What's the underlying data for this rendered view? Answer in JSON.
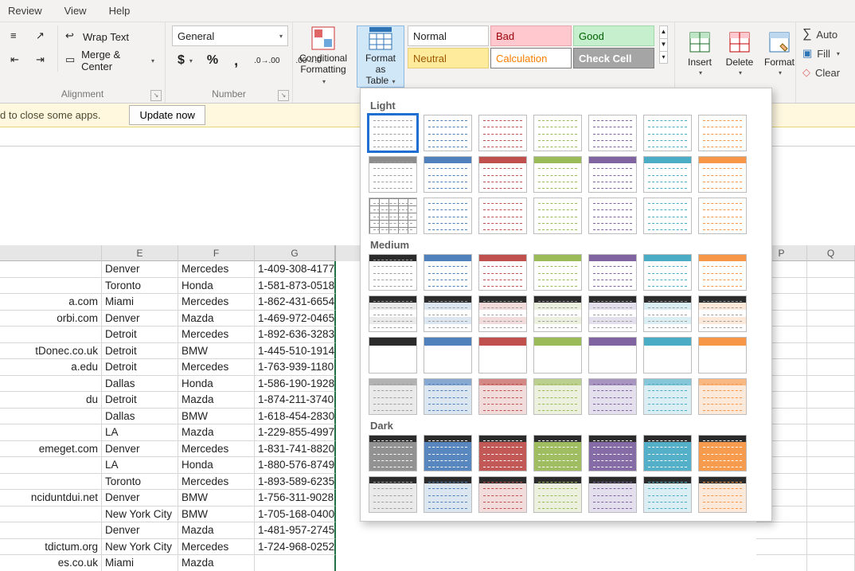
{
  "menu": {
    "review": "Review",
    "view": "View",
    "help": "Help"
  },
  "alignment": {
    "wrap": "Wrap Text",
    "merge": "Merge & Center",
    "group": "Alignment"
  },
  "number": {
    "format": "General",
    "group": "Number"
  },
  "cond_fmt": {
    "line1": "Conditional",
    "line2": "Formatting"
  },
  "fmt_table": {
    "line1": "Format as",
    "line2": "Table"
  },
  "styles": {
    "normal": "Normal",
    "bad": "Bad",
    "good": "Good",
    "neutral": "Neutral",
    "calc": "Calculation",
    "check": "Check Cell"
  },
  "cells": {
    "insert": "Insert",
    "delete": "Delete",
    "format": "Format"
  },
  "editing": {
    "autosum": "Auto",
    "fill": "Fill",
    "clear": "Clear"
  },
  "notif": {
    "msg": "d to close some apps.",
    "btn": "Update now"
  },
  "headers": {
    "e": "E",
    "f": "F",
    "g": "G",
    "p": "P",
    "q": "Q"
  },
  "rows": [
    {
      "d": "",
      "e": "Denver",
      "f": "Mercedes",
      "g": "1-409-308-4177"
    },
    {
      "d": "",
      "e": "Toronto",
      "f": "Honda",
      "g": "1-581-873-0518"
    },
    {
      "d": "a.com",
      "e": "Miami",
      "f": "Mercedes",
      "g": "1-862-431-6654"
    },
    {
      "d": "orbi.com",
      "e": "Denver",
      "f": "Mazda",
      "g": "1-469-972-0465"
    },
    {
      "d": "",
      "e": "Detroit",
      "f": "Mercedes",
      "g": "1-892-636-3283"
    },
    {
      "d": "tDonec.co.uk",
      "e": "Detroit",
      "f": "BMW",
      "g": "1-445-510-1914"
    },
    {
      "d": "a.edu",
      "e": "Detroit",
      "f": "Mercedes",
      "g": "1-763-939-1180"
    },
    {
      "d": "",
      "e": "Dallas",
      "f": "Honda",
      "g": "1-586-190-1928"
    },
    {
      "d": "du",
      "e": "Detroit",
      "f": "Mazda",
      "g": "1-874-211-3740"
    },
    {
      "d": "",
      "e": "Dallas",
      "f": "BMW",
      "g": "1-618-454-2830"
    },
    {
      "d": "",
      "e": "LA",
      "f": "Mazda",
      "g": "1-229-855-4997"
    },
    {
      "d": "emeget.com",
      "e": "Denver",
      "f": "Mercedes",
      "g": "1-831-741-8820"
    },
    {
      "d": "",
      "e": "LA",
      "f": "Honda",
      "g": "1-880-576-8749"
    },
    {
      "d": "",
      "e": "Toronto",
      "f": "Mercedes",
      "g": "1-893-589-6235"
    },
    {
      "d": "nciduntdui.net",
      "e": "Denver",
      "f": "BMW",
      "g": "1-756-311-9028"
    },
    {
      "d": "",
      "e": "New York City",
      "f": "BMW",
      "g": "1-705-168-0400"
    },
    {
      "d": "",
      "e": "Denver",
      "f": "Mazda",
      "g": "1-481-957-2745"
    },
    {
      "d": "tdictum.org",
      "e": "New York City",
      "f": "Mercedes",
      "g": "1-724-968-0252"
    },
    {
      "d": "es.co.uk",
      "e": "Miami",
      "f": "Mazda",
      "g": ""
    }
  ],
  "table_dropdown": {
    "light": "Light",
    "medium": "Medium",
    "dark": "Dark"
  }
}
